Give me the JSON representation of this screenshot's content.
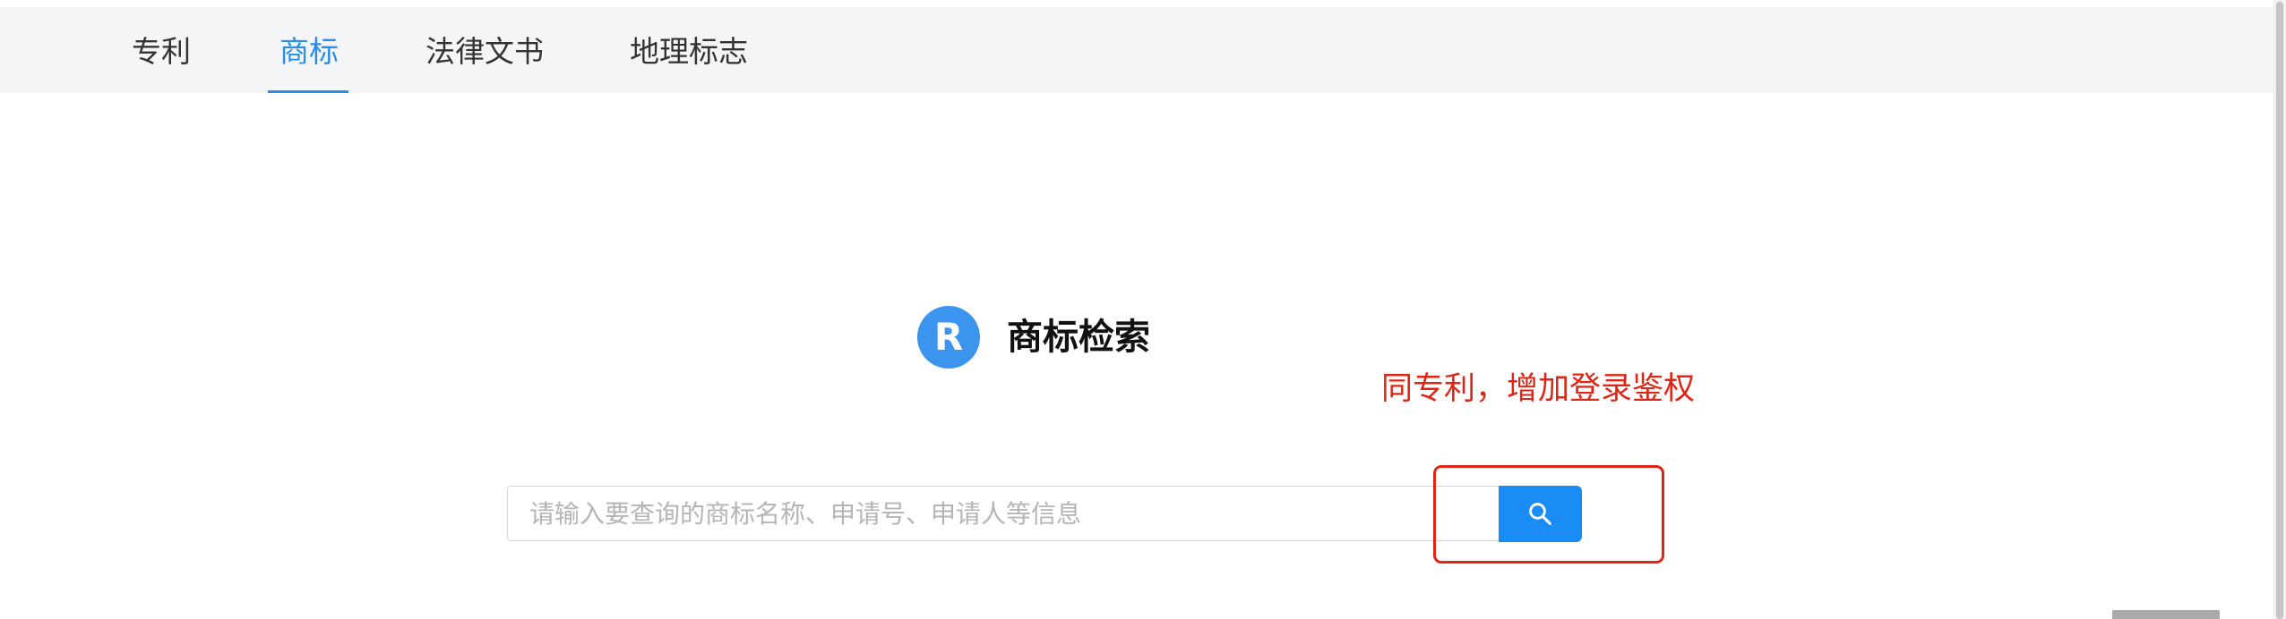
{
  "tabs": [
    {
      "label": "专利",
      "active": false
    },
    {
      "label": "商标",
      "active": true
    },
    {
      "label": "法律文书",
      "active": false
    },
    {
      "label": "地理标志",
      "active": false
    }
  ],
  "logo": {
    "letter": "R"
  },
  "page_title": "商标检索",
  "annotation": {
    "text": "同专利，增加登录鉴权",
    "color": "#e02515"
  },
  "search": {
    "value": "",
    "placeholder": "请输入要查询的商标名称、申请号、申请人等信息",
    "button_icon": "search-icon"
  },
  "colors": {
    "accent": "#2a8ee8",
    "button": "#1a8cf5",
    "tab_bar_bg": "#f4f5f7"
  }
}
